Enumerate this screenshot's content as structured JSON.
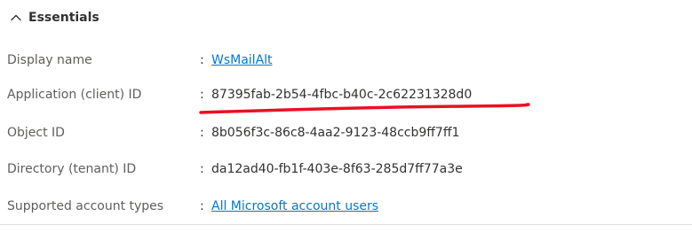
{
  "essentials": {
    "title": "Essentials",
    "expanded": true
  },
  "properties": [
    {
      "label": "Display name",
      "separator": ":",
      "value": "WsMailAlt",
      "is_link": true
    },
    {
      "label": "Application (client) ID",
      "separator": ":",
      "value": "87395fab-2b54-4fbc-b40c-2c62231328d0",
      "is_link": false
    },
    {
      "label": "Object ID",
      "separator": ":",
      "value": "8b056f3c-86c8-4aa2-9123-48ccb9ff7ff1",
      "is_link": false
    },
    {
      "label": "Directory (tenant) ID",
      "separator": ":",
      "value": "da12ad40-fb1f-403e-8f63-285d7ff77a3e",
      "is_link": false
    },
    {
      "label": "Supported account types",
      "separator": ":",
      "value": "All Microsoft account users",
      "is_link": true
    }
  ],
  "annotation": {
    "type": "red-underline",
    "target": "Application (client) ID",
    "color": "#e81123"
  },
  "colors": {
    "link": "#0078d4",
    "label": "#605e5c",
    "text": "#323130",
    "divider": "#e1dfdd"
  }
}
